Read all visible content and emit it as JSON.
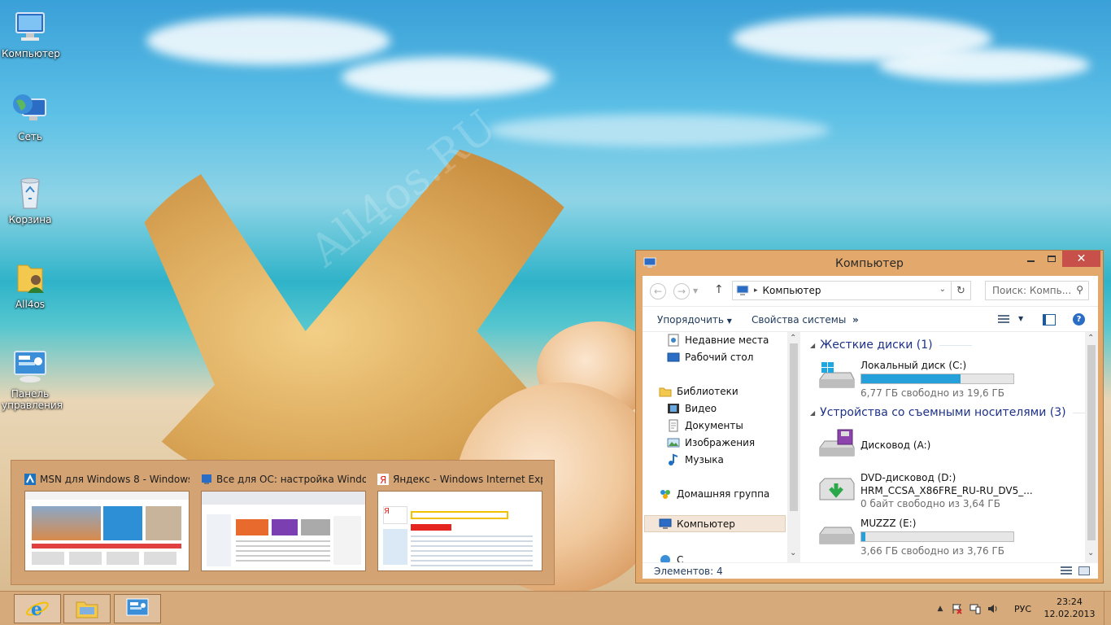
{
  "desktop": {
    "watermark": "All4os.RU",
    "icons": [
      {
        "label": "Компьютер",
        "icon": "computer-icon"
      },
      {
        "label": "Сеть",
        "icon": "network-icon"
      },
      {
        "label": "Корзина",
        "icon": "recycle-bin-icon"
      },
      {
        "label": "All4os",
        "icon": "user-folder-icon"
      },
      {
        "label": "Панель управления",
        "icon": "control-panel-icon"
      }
    ]
  },
  "thumbnails": [
    {
      "title": "MSN для Windows 8 - Windows...",
      "icon": "msn-icon"
    },
    {
      "title": "Все для ОС: настройка Windo...",
      "icon": "all4os-icon"
    },
    {
      "title": "Яндекс - Windows Internet Expl...",
      "icon": "yandex-icon"
    }
  ],
  "explorer": {
    "title": "Компьютер",
    "address": "Компьютер",
    "search_placeholder": "Поиск: Компь...",
    "commands": {
      "organize": "Упорядочить",
      "properties": "Свойства системы",
      "more": "»"
    },
    "nav": {
      "recent": "Недавние места",
      "desktop": "Рабочий стол",
      "libraries": "Библиотеки",
      "video": "Видео",
      "documents": "Документы",
      "pictures": "Изображения",
      "music": "Музыка",
      "homegroup": "Домашняя группа",
      "computer": "Компьютер",
      "network_partial": "С"
    },
    "groups": {
      "hdd": "Жесткие диски (1)",
      "removable": "Устройства со съемными носителями (3)"
    },
    "drives": {
      "c": {
        "name": "Локальный диск (C:)",
        "free": "6,77 ГБ свободно из 19,6 ГБ",
        "used_fraction": 0.655
      },
      "a": {
        "name": "Дисковод (A:)"
      },
      "d": {
        "name": "DVD-дисковод (D:)",
        "label": "HRM_CCSA_X86FRE_RU-RU_DV5_...",
        "free": "0 байт свободно из 3,64 ГБ"
      },
      "e": {
        "name": "MUZZZ (E:)",
        "free": "3,66 ГБ свободно из 3,76 ГБ",
        "used_fraction": 0.027
      }
    },
    "status": "Элементов: 4"
  },
  "taskbar": {
    "apps": [
      "internet-explorer-icon",
      "file-explorer-icon",
      "control-panel-icon"
    ],
    "lang": "РУС",
    "time": "23:24",
    "date": "12.02.2013"
  },
  "colors": {
    "accent": "#e3a86b",
    "bar_fill": "#26a0da",
    "group_header": "#1e3287",
    "close": "#c7504b"
  }
}
